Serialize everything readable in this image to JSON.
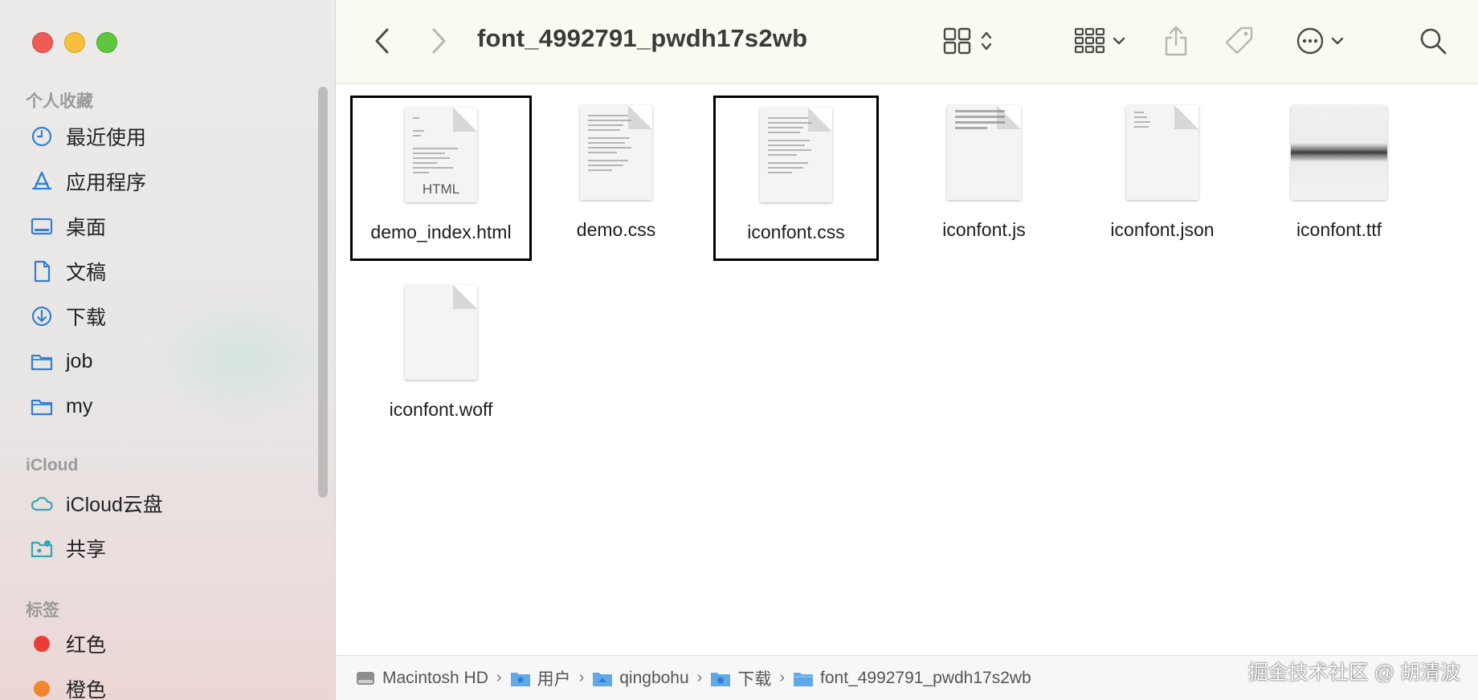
{
  "window": {
    "title": "font_4992791_pwdh17s2wb"
  },
  "sidebar": {
    "sections": [
      {
        "header": "个人收藏",
        "items": [
          {
            "label": "最近使用",
            "icon": "clock-icon"
          },
          {
            "label": "应用程序",
            "icon": "applications-icon"
          },
          {
            "label": "桌面",
            "icon": "desktop-icon"
          },
          {
            "label": "文稿",
            "icon": "document-icon"
          },
          {
            "label": "下载",
            "icon": "download-icon"
          },
          {
            "label": "job",
            "icon": "folder-icon"
          },
          {
            "label": "my",
            "icon": "folder-icon"
          }
        ]
      },
      {
        "header": "iCloud",
        "items": [
          {
            "label": "iCloud云盘",
            "icon": "cloud-icon"
          },
          {
            "label": "共享",
            "icon": "shared-folder-icon"
          }
        ]
      },
      {
        "header": "标签",
        "items": [
          {
            "label": "红色",
            "icon": "tag-dot-icon",
            "color": "#ee3b36"
          },
          {
            "label": "橙色",
            "icon": "tag-dot-icon",
            "color": "#f2862c"
          }
        ]
      }
    ]
  },
  "toolbar": {
    "back": "chevron-left-icon",
    "forward": "chevron-right-icon",
    "view_mode": "grid-view-icon",
    "group": "group-icon",
    "share": "share-icon",
    "tag": "tag-icon",
    "more": "ellipsis-circle-icon",
    "search": "search-icon"
  },
  "files": [
    {
      "name": "demo_index.html",
      "kind": "html",
      "badge": "HTML",
      "selected": true
    },
    {
      "name": "demo.css",
      "kind": "text",
      "selected": false
    },
    {
      "name": "iconfont.css",
      "kind": "text",
      "selected": true
    },
    {
      "name": "iconfont.js",
      "kind": "dense",
      "selected": false
    },
    {
      "name": "iconfont.json",
      "kind": "sparse",
      "selected": false
    },
    {
      "name": "iconfont.ttf",
      "kind": "font",
      "selected": false
    },
    {
      "name": "iconfont.woff",
      "kind": "blank",
      "selected": false
    }
  ],
  "pathbar": {
    "crumbs": [
      {
        "label": "Macintosh HD",
        "icon": "disk-icon"
      },
      {
        "label": "用户",
        "icon": "users-folder-icon"
      },
      {
        "label": "qingbohu",
        "icon": "home-folder-icon"
      },
      {
        "label": "下载",
        "icon": "downloads-folder-icon"
      },
      {
        "label": "font_4992791_pwdh17s2wb",
        "icon": "folder-icon"
      }
    ],
    "separator": "›"
  },
  "watermark": "掘金技术社区 @ 胡清波"
}
